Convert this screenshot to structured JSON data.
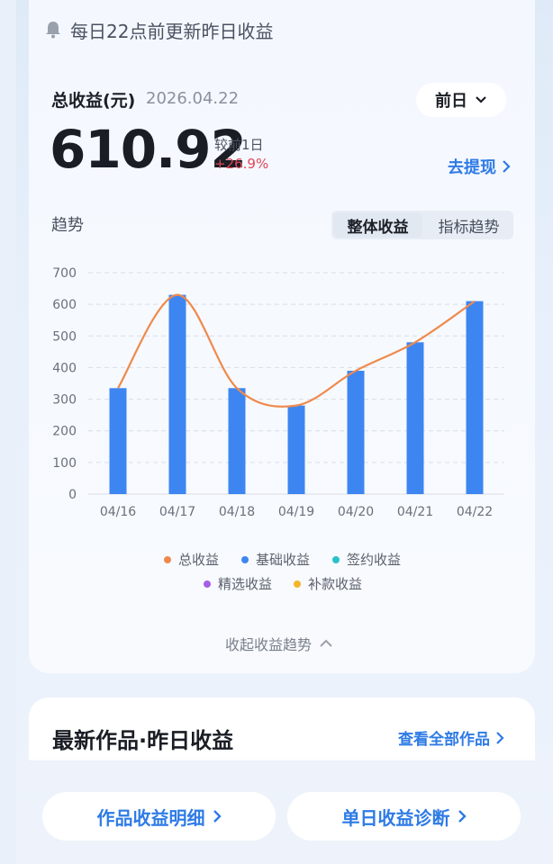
{
  "notice": {
    "text": "每日22点前更新昨日收益"
  },
  "summary": {
    "title": "总收益(元)",
    "date": "2026.04.22",
    "period": "前日",
    "value": "610.92",
    "compare_label": "较前1日",
    "compare_value": "+26.9%",
    "withdraw": "去提现"
  },
  "trend": {
    "label": "趋势",
    "tabs": [
      "整体收益",
      "指标趋势"
    ],
    "active_tab": "整体收益"
  },
  "chart_data": {
    "type": "bar",
    "categories": [
      "04/16",
      "04/17",
      "04/18",
      "04/19",
      "04/20",
      "04/21",
      "04/22"
    ],
    "ylim": [
      0,
      700
    ],
    "yticks": [
      0,
      100,
      200,
      300,
      400,
      500,
      600,
      700
    ],
    "series": [
      {
        "name": "总收益",
        "type": "line",
        "color": "#ef8a4c",
        "values": [
          335,
          630,
          335,
          280,
          390,
          480,
          610
        ]
      },
      {
        "name": "基础收益",
        "type": "bar",
        "color": "#3d86f2",
        "values": [
          335,
          630,
          335,
          280,
          390,
          480,
          610
        ]
      },
      {
        "name": "签约收益",
        "type": "bar",
        "color": "#27c3c9",
        "values": [
          0,
          0,
          0,
          0,
          0,
          0,
          0
        ]
      },
      {
        "name": "精选收益",
        "type": "bar",
        "color": "#a65ee8",
        "values": [
          0,
          0,
          0,
          0,
          0,
          0,
          0
        ]
      },
      {
        "name": "补款收益",
        "type": "bar",
        "color": "#f3b52a",
        "values": [
          0,
          0,
          0,
          0,
          0,
          0,
          0
        ]
      }
    ],
    "grid": true,
    "legend": "bottom"
  },
  "collapse": {
    "label": "收起收益趋势"
  },
  "works": {
    "title": "最新作品·昨日收益",
    "link": "查看全部作品"
  },
  "bottom": {
    "detail": "作品收益明细",
    "diagnose": "单日收益诊断"
  },
  "colors": {
    "accent": "#2e7be6",
    "up": "#e0465a"
  }
}
